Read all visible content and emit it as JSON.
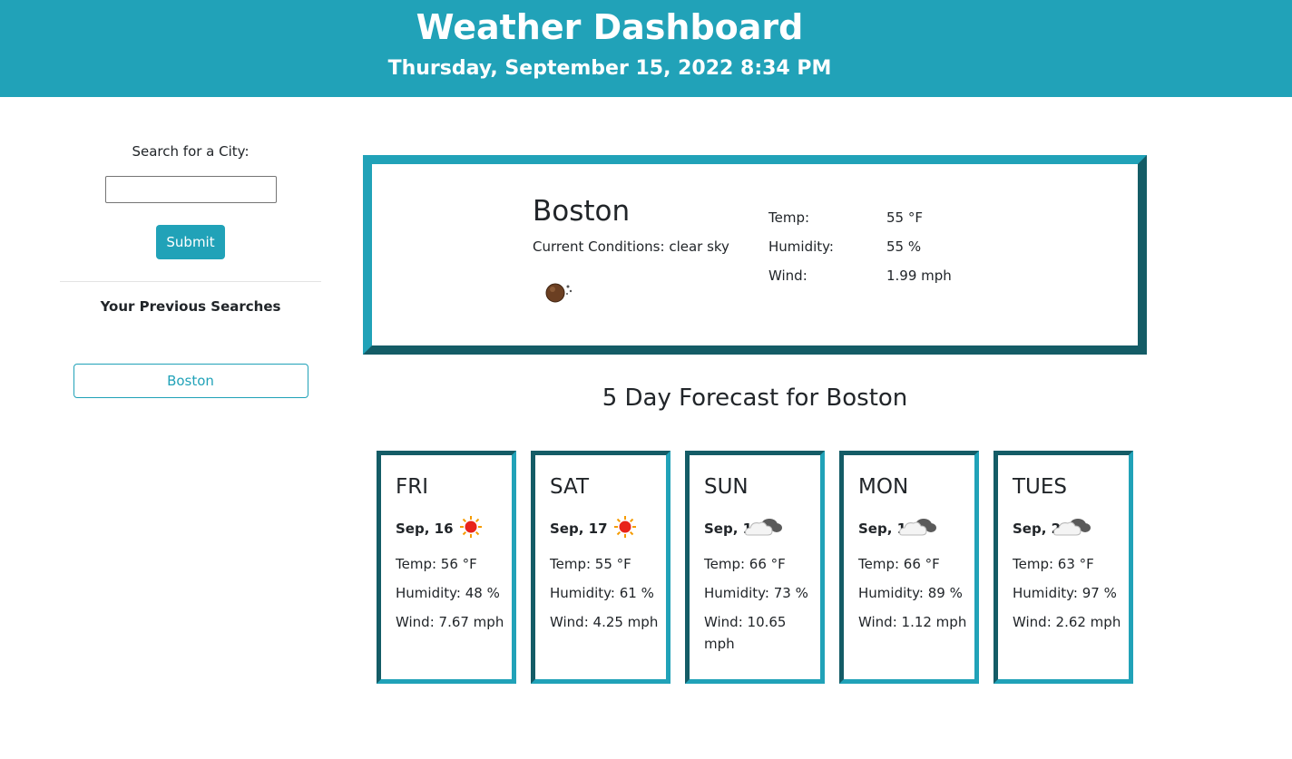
{
  "header": {
    "title": "Weather Dashboard",
    "datetime": "Thursday, September 15, 2022 8:34 PM"
  },
  "sidebar": {
    "search_label": "Search for a City:",
    "search_value": "",
    "submit_label": "Submit",
    "previous_title": "Your Previous Searches",
    "history": [
      "Boston"
    ]
  },
  "current": {
    "city": "Boston",
    "conditions": "Current Conditions: clear sky",
    "icon": "clear-night-icon",
    "temp_label": "Temp:",
    "temp_value": "55 °F",
    "humidity_label": "Humidity:",
    "humidity_value": "55 %",
    "wind_label": "Wind:",
    "wind_value": "1.99 mph"
  },
  "forecast": {
    "title": "5 Day Forecast for Boston",
    "days": [
      {
        "day": "FRI",
        "date": "Sep, 16",
        "icon": "sun-icon",
        "temp": "Temp: 56 °F",
        "humidity": "Humidity: 48 %",
        "wind": "Wind: 7.67 mph"
      },
      {
        "day": "SAT",
        "date": "Sep, 17",
        "icon": "sun-icon",
        "temp": "Temp: 55 °F",
        "humidity": "Humidity: 61 %",
        "wind": "Wind: 4.25 mph"
      },
      {
        "day": "SUN",
        "date": "Sep, 18",
        "icon": "cloud-icon",
        "temp": "Temp: 66 °F",
        "humidity": "Humidity: 73 %",
        "wind": "Wind: 10.65 mph"
      },
      {
        "day": "MON",
        "date": "Sep, 19",
        "icon": "cloud-icon",
        "temp": "Temp: 66 °F",
        "humidity": "Humidity: 89 %",
        "wind": "Wind: 1.12 mph"
      },
      {
        "day": "TUES",
        "date": "Sep, 20",
        "icon": "cloud-icon",
        "temp": "Temp: 63 °F",
        "humidity": "Humidity: 97 %",
        "wind": "Wind: 2.62 mph"
      }
    ]
  },
  "colors": {
    "accent": "#21a2b8",
    "accent_dark": "#145c66"
  }
}
